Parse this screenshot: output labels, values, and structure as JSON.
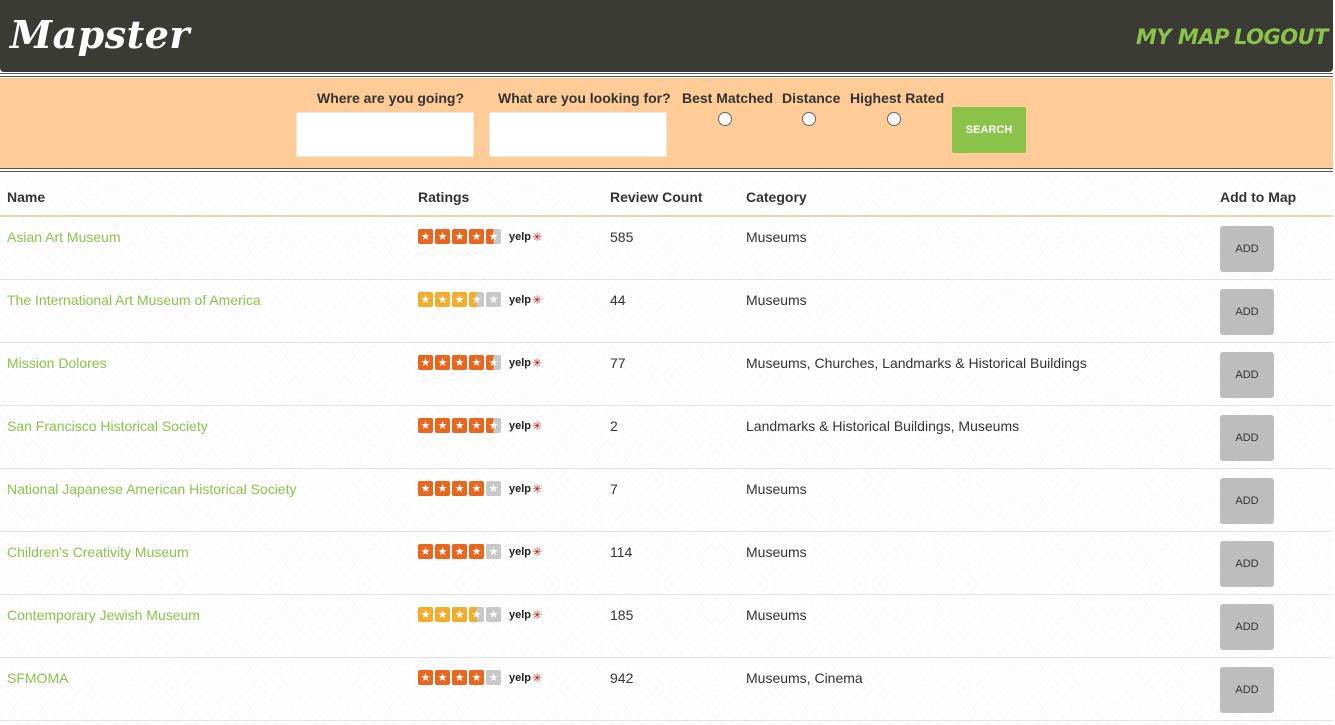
{
  "header": {
    "logo": "Mapster",
    "nav": {
      "my_map": "MY MAP",
      "logout": "LOGOUT"
    }
  },
  "search": {
    "where_label": "Where are you going?",
    "where_value": "",
    "what_label": "What are you looking for?",
    "what_value": "",
    "sort_options": [
      "Best Matched",
      "Distance",
      "Highest Rated"
    ],
    "search_button": "SEARCH"
  },
  "table": {
    "columns": [
      "Name",
      "Ratings",
      "Review Count",
      "Category",
      "Add to Map"
    ],
    "rating_source": "yelp",
    "add_label": "ADD",
    "rows": [
      {
        "name": "Asian Art Museum",
        "rating": 4.5,
        "reviews": "585",
        "category": "Museums"
      },
      {
        "name": "The International Art Museum of America",
        "rating": 3.5,
        "reviews": "44",
        "category": "Museums"
      },
      {
        "name": "Mission Dolores",
        "rating": 4.5,
        "reviews": "77",
        "category": "Museums, Churches, Landmarks & Historical Buildings"
      },
      {
        "name": "San Francisco Historical Society",
        "rating": 4.5,
        "reviews": "2",
        "category": "Landmarks & Historical Buildings, Museums"
      },
      {
        "name": "National Japanese American Historical Society",
        "rating": 4,
        "reviews": "7",
        "category": "Museums"
      },
      {
        "name": "Children's Creativity Museum",
        "rating": 4,
        "reviews": "114",
        "category": "Museums"
      },
      {
        "name": "Contemporary Jewish Museum",
        "rating": 3.5,
        "reviews": "185",
        "category": "Museums"
      },
      {
        "name": "SFMOMA",
        "rating": 4,
        "reviews": "942",
        "category": "Museums, Cinema"
      }
    ]
  },
  "colors": {
    "header_bg": "#3b3b36",
    "accent_green": "#8bc34a",
    "search_bg": "#ffcb96",
    "star_high": "#e8661e",
    "star_mid": "#f2ad2e",
    "star_empty": "#c8c8c8",
    "yelp_red": "#c41200",
    "add_button": "#bdbdbd"
  }
}
